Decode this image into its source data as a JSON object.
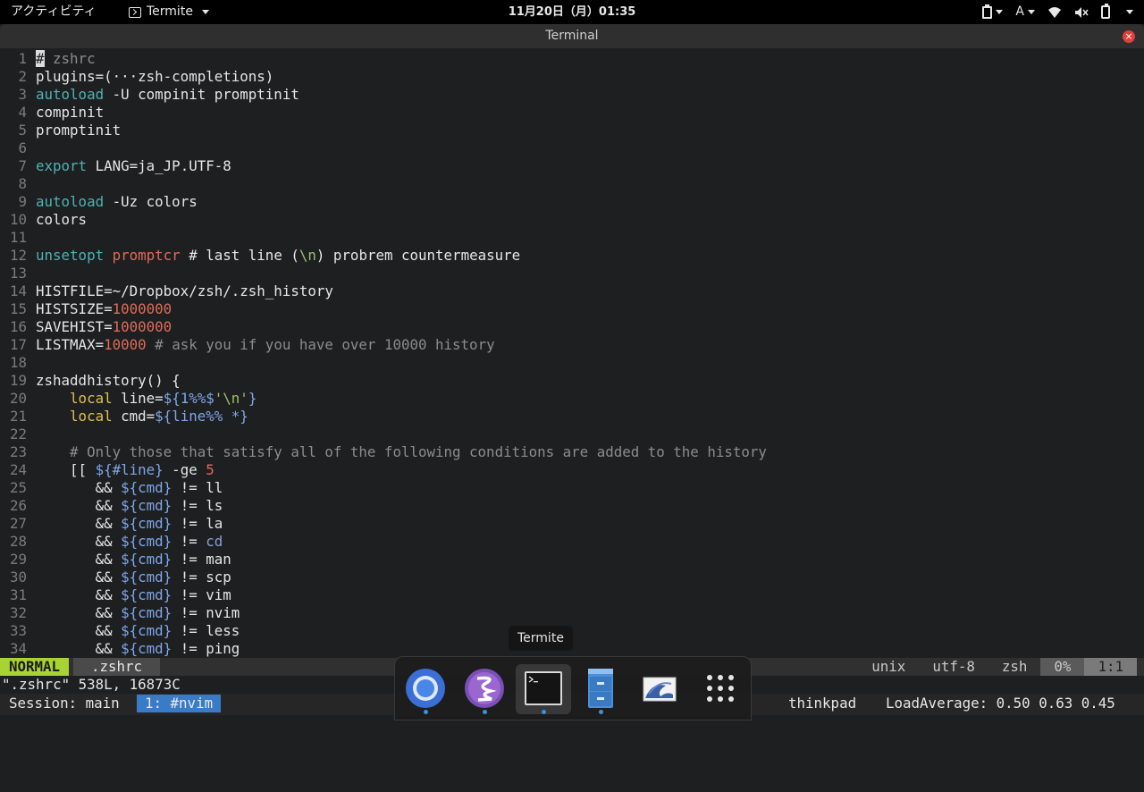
{
  "topbar": {
    "activities": "アクティビティ",
    "app_menu": "Termite",
    "clock": "11月20日（月）01:35",
    "input_method": "A"
  },
  "window": {
    "title": "Terminal",
    "close_glyph": "×"
  },
  "editor": {
    "lines": [
      {
        "n": "1",
        "segs": [
          {
            "t": "#",
            "c": "cursor"
          },
          {
            "t": " zshrc",
            "c": "com"
          }
        ]
      },
      {
        "n": "2",
        "segs": [
          {
            "t": "plugins=(···zsh-completions)",
            "c": ""
          }
        ]
      },
      {
        "n": "3",
        "segs": [
          {
            "t": "autoload",
            "c": "ex"
          },
          {
            "t": " -U compinit promptinit",
            "c": ""
          }
        ]
      },
      {
        "n": "4",
        "segs": [
          {
            "t": "compinit",
            "c": ""
          }
        ]
      },
      {
        "n": "5",
        "segs": [
          {
            "t": "promptinit",
            "c": ""
          }
        ]
      },
      {
        "n": "6",
        "segs": []
      },
      {
        "n": "7",
        "segs": [
          {
            "t": "export",
            "c": "ex"
          },
          {
            "t": " LANG=ja_JP.UTF-8",
            "c": ""
          }
        ]
      },
      {
        "n": "8",
        "segs": []
      },
      {
        "n": "9",
        "segs": [
          {
            "t": "autoload",
            "c": "ex"
          },
          {
            "t": " -Uz colors",
            "c": ""
          }
        ]
      },
      {
        "n": "10",
        "segs": [
          {
            "t": "colors",
            "c": ""
          }
        ]
      },
      {
        "n": "11",
        "segs": []
      },
      {
        "n": "12",
        "segs": [
          {
            "t": "unsetopt",
            "c": "ex"
          },
          {
            "t": " ",
            "c": ""
          },
          {
            "t": "promptcr",
            "c": "num"
          },
          {
            "t": " # last line (",
            "c": ""
          },
          {
            "t": "\\n",
            "c": "str"
          },
          {
            "t": ") probrem countermeasure",
            "c": ""
          }
        ]
      },
      {
        "n": "13",
        "segs": []
      },
      {
        "n": "14",
        "segs": [
          {
            "t": "HISTFILE=~/Dropbox/zsh/.zsh_history",
            "c": ""
          }
        ]
      },
      {
        "n": "15",
        "segs": [
          {
            "t": "HISTSIZE=",
            "c": ""
          },
          {
            "t": "1000000",
            "c": "num"
          }
        ]
      },
      {
        "n": "16",
        "segs": [
          {
            "t": "SAVEHIST=",
            "c": ""
          },
          {
            "t": "1000000",
            "c": "num"
          }
        ]
      },
      {
        "n": "17",
        "segs": [
          {
            "t": "LISTMAX=",
            "c": ""
          },
          {
            "t": "10000",
            "c": "num"
          },
          {
            "t": " # ask you if you have over 10000 history",
            "c": "com"
          }
        ]
      },
      {
        "n": "18",
        "segs": []
      },
      {
        "n": "19",
        "segs": [
          {
            "t": "zshaddhistory() {",
            "c": ""
          }
        ]
      },
      {
        "n": "20",
        "segs": [
          {
            "t": "    ",
            "c": ""
          },
          {
            "t": "local",
            "c": "kw"
          },
          {
            "t": " line=",
            "c": ""
          },
          {
            "t": "${1%%$",
            "c": "var"
          },
          {
            "t": "'\\n'",
            "c": "str"
          },
          {
            "t": "}",
            "c": "var"
          }
        ]
      },
      {
        "n": "21",
        "segs": [
          {
            "t": "    ",
            "c": ""
          },
          {
            "t": "local",
            "c": "kw"
          },
          {
            "t": " cmd=",
            "c": ""
          },
          {
            "t": "${line%% *}",
            "c": "var"
          }
        ]
      },
      {
        "n": "22",
        "segs": []
      },
      {
        "n": "23",
        "segs": [
          {
            "t": "    # Only those that satisfy all of the following conditions are added to the history",
            "c": "com"
          }
        ]
      },
      {
        "n": "24",
        "segs": [
          {
            "t": "    [[ ",
            "c": ""
          },
          {
            "t": "${#line}",
            "c": "var"
          },
          {
            "t": " -ge ",
            "c": ""
          },
          {
            "t": "5",
            "c": "num"
          }
        ]
      },
      {
        "n": "25",
        "segs": [
          {
            "t": "       && ",
            "c": ""
          },
          {
            "t": "${cmd}",
            "c": "var"
          },
          {
            "t": " != ll",
            "c": ""
          }
        ]
      },
      {
        "n": "26",
        "segs": [
          {
            "t": "       && ",
            "c": ""
          },
          {
            "t": "${cmd}",
            "c": "var"
          },
          {
            "t": " != ls",
            "c": ""
          }
        ]
      },
      {
        "n": "27",
        "segs": [
          {
            "t": "       && ",
            "c": ""
          },
          {
            "t": "${cmd}",
            "c": "var"
          },
          {
            "t": " != la",
            "c": ""
          }
        ]
      },
      {
        "n": "28",
        "segs": [
          {
            "t": "       && ",
            "c": ""
          },
          {
            "t": "${cmd}",
            "c": "var"
          },
          {
            "t": " != ",
            "c": ""
          },
          {
            "t": "cd",
            "c": "cd"
          }
        ]
      },
      {
        "n": "29",
        "segs": [
          {
            "t": "       && ",
            "c": ""
          },
          {
            "t": "${cmd}",
            "c": "var"
          },
          {
            "t": " != man",
            "c": ""
          }
        ]
      },
      {
        "n": "30",
        "segs": [
          {
            "t": "       && ",
            "c": ""
          },
          {
            "t": "${cmd}",
            "c": "var"
          },
          {
            "t": " != scp",
            "c": ""
          }
        ]
      },
      {
        "n": "31",
        "segs": [
          {
            "t": "       && ",
            "c": ""
          },
          {
            "t": "${cmd}",
            "c": "var"
          },
          {
            "t": " != vim",
            "c": ""
          }
        ]
      },
      {
        "n": "32",
        "segs": [
          {
            "t": "       && ",
            "c": ""
          },
          {
            "t": "${cmd}",
            "c": "var"
          },
          {
            "t": " != nvim",
            "c": ""
          }
        ]
      },
      {
        "n": "33",
        "segs": [
          {
            "t": "       && ",
            "c": ""
          },
          {
            "t": "${cmd}",
            "c": "var"
          },
          {
            "t": " != less",
            "c": ""
          }
        ]
      },
      {
        "n": "34",
        "segs": [
          {
            "t": "       && ",
            "c": ""
          },
          {
            "t": "${cmd}",
            "c": "var"
          },
          {
            "t": " != ping",
            "c": ""
          }
        ]
      }
    ]
  },
  "statusline": {
    "mode": "NORMAL",
    "file": ".zshrc",
    "format": "unix",
    "encoding": "utf-8",
    "filetype": "zsh",
    "percent": "0%",
    "position": "1:1"
  },
  "cmdline": "\".zshrc\" 538L, 16873C",
  "tmux": {
    "session": "Session: main",
    "window": "1: #nvim",
    "host": "thinkpad",
    "load": "LoadAverage: 0.50 0.63 0.45"
  },
  "dock": {
    "tooltip": "Termite",
    "items": [
      {
        "name": "chrome-icon",
        "running": true,
        "active": false
      },
      {
        "name": "emacs-icon",
        "running": true,
        "active": false
      },
      {
        "name": "terminal-icon",
        "running": true,
        "active": true
      },
      {
        "name": "file-cabinet-icon",
        "running": true,
        "active": false
      },
      {
        "name": "image-viewer-icon",
        "running": false,
        "active": false
      },
      {
        "name": "app-grid-icon",
        "running": false,
        "active": false
      }
    ]
  },
  "colors": {
    "mode_badge": "#a8d332",
    "tmux_window": "#3a7bc8",
    "keyword": "#e0c14a",
    "builtin": "#4fb3b3",
    "number": "#e06c5a",
    "variable": "#7fa6e8",
    "comment": "#8c8c8c",
    "string": "#9ec06c"
  }
}
